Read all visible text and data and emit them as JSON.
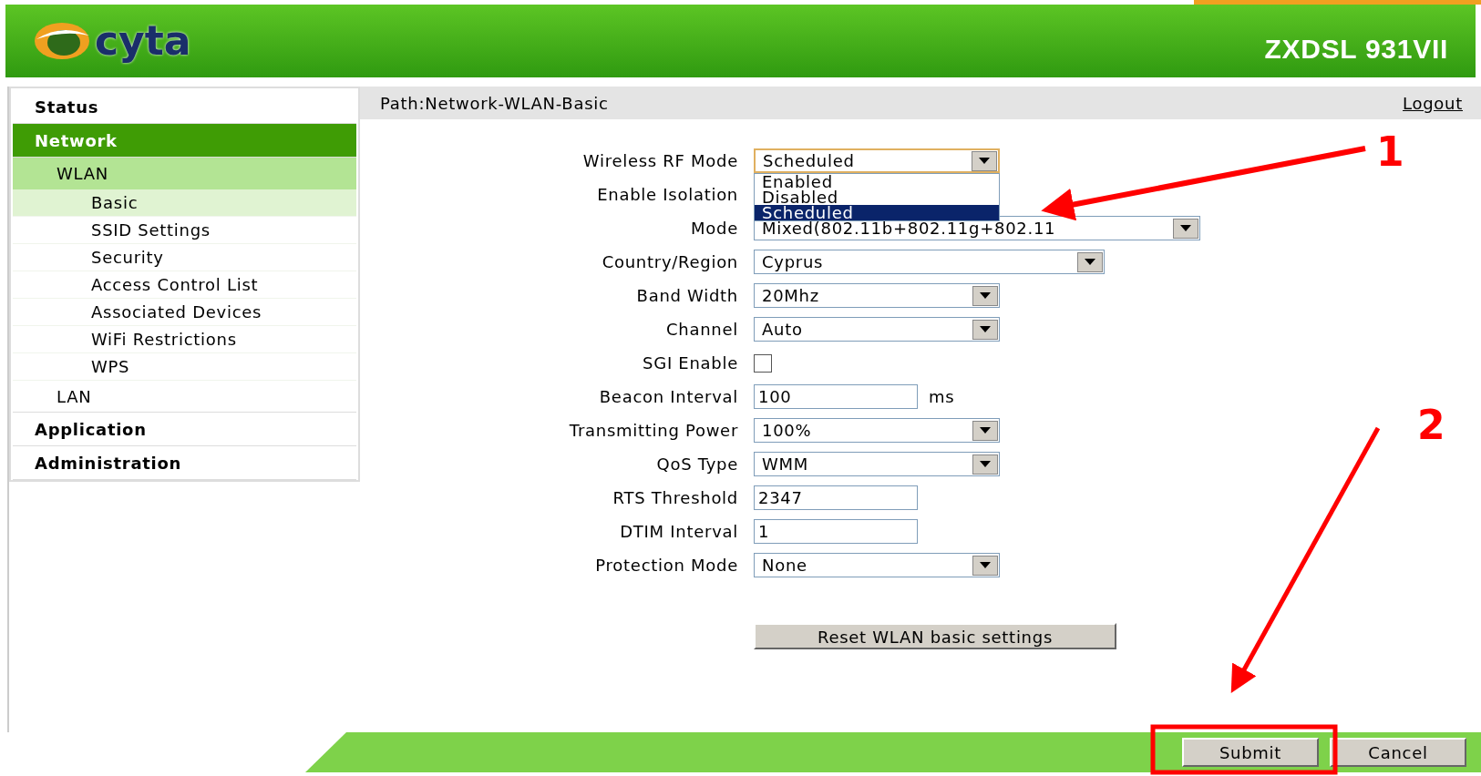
{
  "header": {
    "logo_text": "cyta",
    "model": "ZXDSL 931VII"
  },
  "sidebar": {
    "items": [
      {
        "label": "Status",
        "selected": false
      },
      {
        "label": "Network",
        "selected": true,
        "children": [
          {
            "label": "WLAN",
            "selected": true,
            "children": [
              {
                "label": "Basic",
                "selected": true
              },
              {
                "label": "SSID Settings",
                "selected": false
              },
              {
                "label": "Security",
                "selected": false
              },
              {
                "label": "Access Control List",
                "selected": false
              },
              {
                "label": "Associated Devices",
                "selected": false
              },
              {
                "label": "WiFi Restrictions",
                "selected": false
              },
              {
                "label": "WPS",
                "selected": false
              }
            ]
          },
          {
            "label": "LAN",
            "selected": false
          }
        ]
      },
      {
        "label": "Application",
        "selected": false
      },
      {
        "label": "Administration",
        "selected": false
      }
    ]
  },
  "path": "Path:Network-WLAN-Basic",
  "logout": "Logout",
  "form": [
    {
      "label": "Wireless RF Mode",
      "kind": "select",
      "value": "Scheduled",
      "expanded": true,
      "options": [
        {
          "label": "Enabled",
          "selected": false
        },
        {
          "label": "Disabled",
          "selected": false
        },
        {
          "label": "Scheduled",
          "selected": true
        }
      ]
    },
    {
      "label": "Enable Isolation",
      "kind": "covered"
    },
    {
      "label": "Mode",
      "kind": "select",
      "value": "Mixed(802.11b+802.11g+802.11",
      "expanded": false
    },
    {
      "label": "Country/Region",
      "kind": "select",
      "value": "Cyprus",
      "expanded": false
    },
    {
      "label": "Band Width",
      "kind": "select",
      "value": "20Mhz",
      "expanded": false
    },
    {
      "label": "Channel",
      "kind": "select",
      "value": "Auto",
      "expanded": false
    },
    {
      "label": "SGI Enable",
      "kind": "checkbox",
      "checked": false
    },
    {
      "label": "Beacon Interval",
      "kind": "text",
      "value": "100",
      "unit": "ms"
    },
    {
      "label": "Transmitting Power",
      "kind": "select",
      "value": "100%",
      "expanded": false
    },
    {
      "label": "QoS Type",
      "kind": "select",
      "value": "WMM",
      "expanded": false
    },
    {
      "label": "RTS Threshold",
      "kind": "text",
      "value": "2347"
    },
    {
      "label": "DTIM Interval",
      "kind": "text",
      "value": "1"
    },
    {
      "label": "Protection Mode",
      "kind": "select",
      "value": "None",
      "expanded": false
    }
  ],
  "reset_button": "Reset WLAN basic settings",
  "buttons": [
    "Submit",
    "Cancel"
  ],
  "annotations": [
    "1",
    "2"
  ]
}
